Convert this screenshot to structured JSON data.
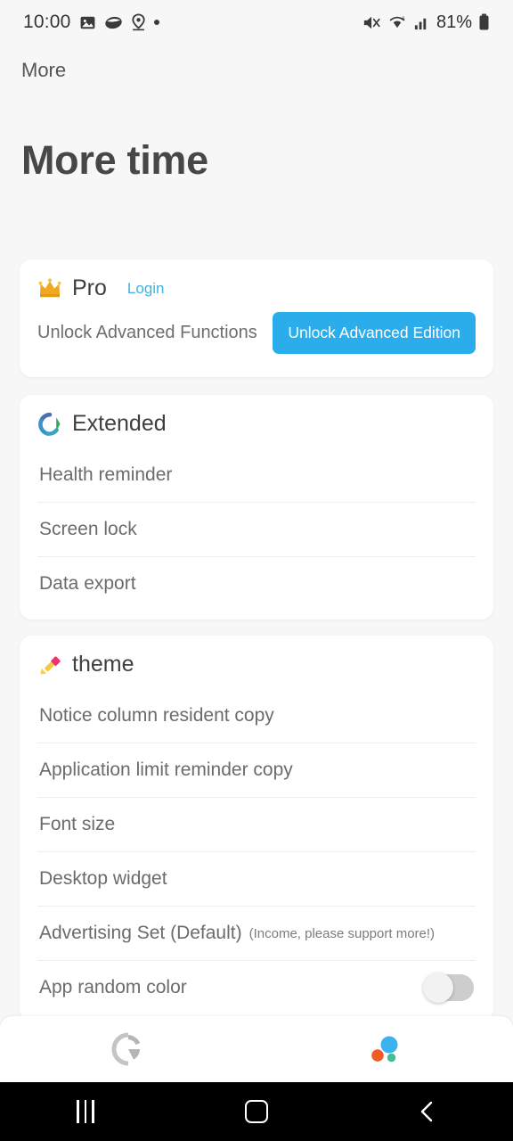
{
  "status_bar": {
    "time": "10:00",
    "battery_percent": "81%",
    "left_icons": [
      "image-icon",
      "eye-shape-icon",
      "location-pin-icon",
      "dot-icon"
    ],
    "right_icons": [
      "mute-icon",
      "wifi6-icon",
      "signal-bars-icon",
      "battery-icon"
    ]
  },
  "toolbar": {
    "title": "More"
  },
  "page": {
    "title": "More time"
  },
  "pro_card": {
    "icon": "crown-icon",
    "title": "Pro",
    "login_label": "Login",
    "description": "Unlock Advanced Functions",
    "button_label": "Unlock Advanced Edition",
    "button_color": "#2badeb",
    "link_color": "#3fb3e0"
  },
  "extended_card": {
    "icon": "recycle-circle-icon",
    "title": "Extended",
    "items": [
      {
        "label": "Health reminder"
      },
      {
        "label": "Screen lock"
      },
      {
        "label": "Data export"
      }
    ]
  },
  "theme_card": {
    "icon": "paintbrush-icon",
    "title": "theme",
    "items": [
      {
        "label": "Notice column resident copy",
        "sub": ""
      },
      {
        "label": "Application limit reminder copy",
        "sub": ""
      },
      {
        "label": "Font size",
        "sub": ""
      },
      {
        "label": "Desktop widget",
        "sub": ""
      },
      {
        "label": "Advertising Set (Default)",
        "sub": "(Income, please support more!)"
      },
      {
        "label": "App random color",
        "sub": "",
        "toggle": "off"
      }
    ]
  },
  "bottom_nav": {
    "items": [
      {
        "icon": "segmented-circle-icon",
        "state": "inactive"
      },
      {
        "icon": "color-dots-icon",
        "state": "active"
      }
    ]
  },
  "android_nav": {
    "recents": "recents-icon",
    "home": "home-icon",
    "back": "back-icon"
  }
}
